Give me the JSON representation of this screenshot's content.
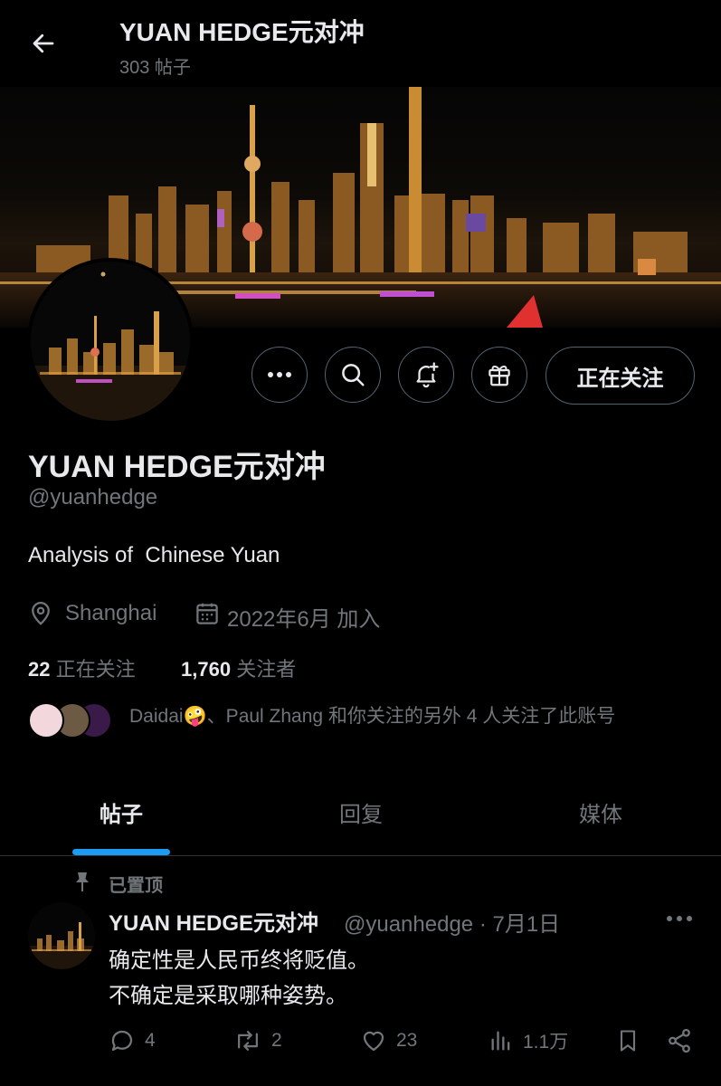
{
  "header": {
    "title": "YUAN HEDGE元对冲",
    "post_count": "303 帖子"
  },
  "actions": {
    "following_label": "正在关注"
  },
  "profile": {
    "name": "YUAN HEDGE元对冲",
    "handle": "@yuanhedge",
    "bio": "Analysis of  Chinese Yuan",
    "location": "Shanghai",
    "joined": "2022年6月 加入",
    "following_count": "22",
    "following_label": "正在关注",
    "followers_count": "1,760",
    "followers_label": "关注者",
    "followed_by": "Daidai🤪、Paul Zhang 和你关注的另外 4 人关注了此账号"
  },
  "tabs": [
    {
      "label": "帖子"
    },
    {
      "label": "回复"
    },
    {
      "label": "媒体"
    }
  ],
  "post": {
    "pinned_label": "已置顶",
    "author": "YUAN HEDGE元对冲",
    "handle_date": "@yuanhedge · 7月1日",
    "line1": "确定性是人民币终将贬值。",
    "line2": "不确定是采取哪种姿势。",
    "replies": "4",
    "reposts": "2",
    "likes": "23",
    "views": "1.1万"
  },
  "colors": {
    "accent": "#1d9bf0",
    "muted": "#71767b",
    "text": "#e7e9ea",
    "border": "#536471"
  }
}
